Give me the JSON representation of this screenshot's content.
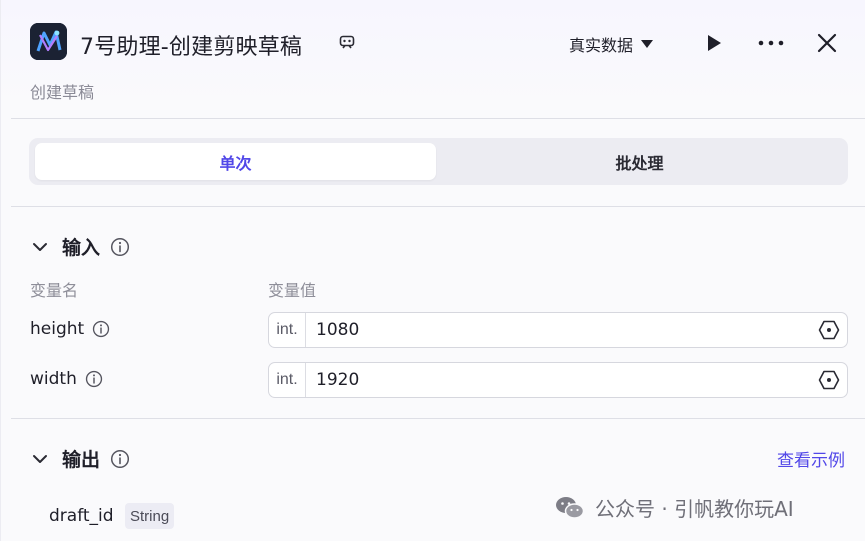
{
  "header": {
    "title": "7号助理-创建剪映草稿",
    "subtitle": "创建草稿",
    "data_mode": "真实数据",
    "logo_icon": "app-logo-icon",
    "title_icon": "robot-badge-icon"
  },
  "tabs": [
    {
      "label": "单次",
      "active": true
    },
    {
      "label": "批处理",
      "active": false
    }
  ],
  "input_section": {
    "title": "输入",
    "col_name": "变量名",
    "col_value": "变量值",
    "rows": [
      {
        "name": "height",
        "type": "int.",
        "value": "1080"
      },
      {
        "name": "width",
        "type": "int.",
        "value": "1920"
      }
    ]
  },
  "output_section": {
    "title": "输出",
    "example_link": "查看示例",
    "rows": [
      {
        "name": "draft_id",
        "type": "String"
      }
    ]
  },
  "watermark": "公众号 · 引帆教你玩AI",
  "colors": {
    "accent": "#5147e8",
    "text": "#1f1f29",
    "muted": "#8e8e99"
  }
}
